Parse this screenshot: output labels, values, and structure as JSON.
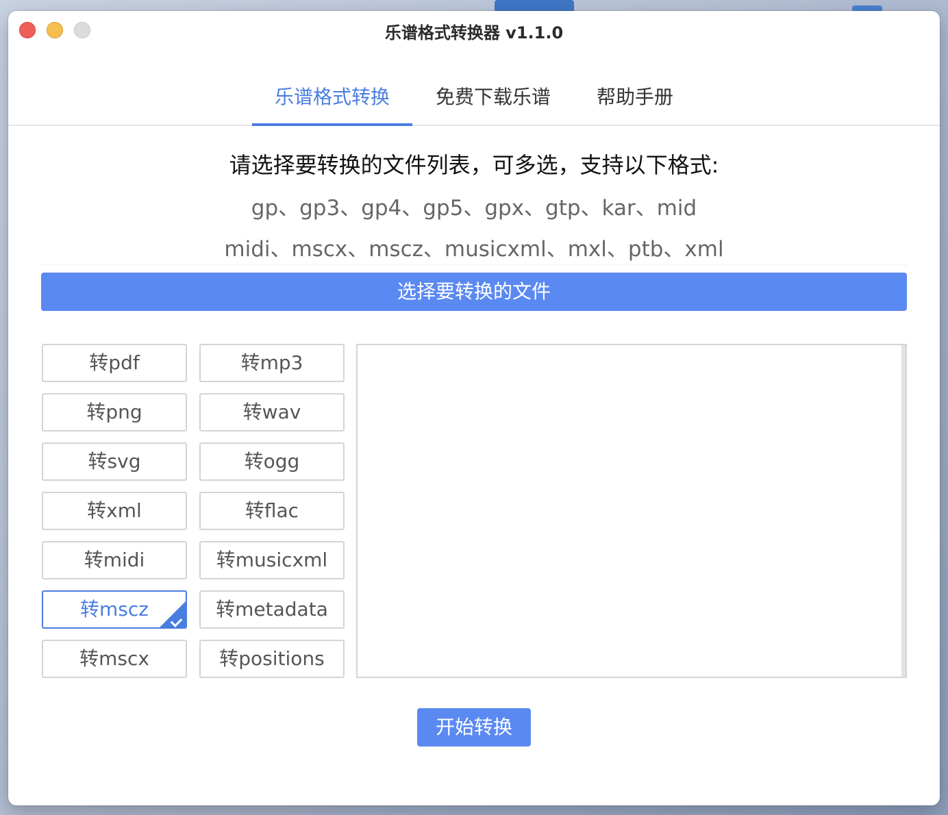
{
  "window": {
    "title": "乐谱格式转换器 v1.1.0"
  },
  "tabs": [
    {
      "label": "乐谱格式转换",
      "active": true
    },
    {
      "label": "免费下载乐谱",
      "active": false
    },
    {
      "label": "帮助手册",
      "active": false
    }
  ],
  "main": {
    "prompt": "请选择要转换的文件列表，可多选，支持以下格式:",
    "formats_line1": "gp、gp3、gp4、gp5、gpx、gtp、kar、mid",
    "formats_line2": "midi、mscx、mscz、musicxml、mxl、ptb、xml",
    "select_button": "选择要转换的文件",
    "start_button": "开始转换",
    "file_list": []
  },
  "options": {
    "col1": [
      {
        "label": "转pdf",
        "checked": false
      },
      {
        "label": "转png",
        "checked": false
      },
      {
        "label": "转svg",
        "checked": false
      },
      {
        "label": "转xml",
        "checked": false
      },
      {
        "label": "转midi",
        "checked": false
      },
      {
        "label": "转mscz",
        "checked": true
      },
      {
        "label": "转mscx",
        "checked": false
      }
    ],
    "col2": [
      {
        "label": "转mp3",
        "checked": false
      },
      {
        "label": "转wav",
        "checked": false
      },
      {
        "label": "转ogg",
        "checked": false
      },
      {
        "label": "转flac",
        "checked": false
      },
      {
        "label": "转musicxml",
        "checked": false
      },
      {
        "label": "转metadata",
        "checked": false
      },
      {
        "label": "转positions",
        "checked": false
      }
    ]
  },
  "colors": {
    "accent": "#5b89f2",
    "active_tab": "#4a7de0"
  }
}
